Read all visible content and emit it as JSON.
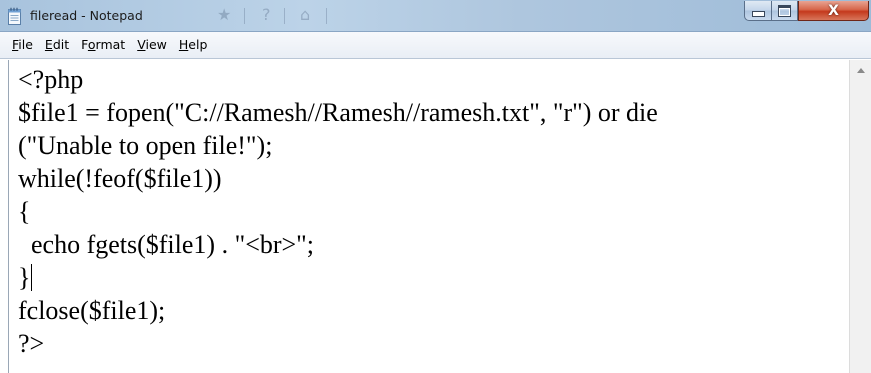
{
  "window": {
    "title": "fileread - Notepad"
  },
  "icons": {
    "app": "notepad-icon",
    "minimize": "minimize-icon",
    "maximize": "maximize-icon",
    "close": "close-icon",
    "scroll_up": "scroll-up-arrow-icon"
  },
  "caption": {
    "close_glyph": "X"
  },
  "menu": {
    "items": [
      {
        "key": "F",
        "rest": "ile"
      },
      {
        "key": "E",
        "rest": "dit"
      },
      {
        "pre": "F",
        "key": "o",
        "rest": "rmat"
      },
      {
        "key": "V",
        "rest": "iew"
      },
      {
        "key": "H",
        "rest": "elp"
      }
    ]
  },
  "editor": {
    "lines": [
      "<?php",
      "$file1 = fopen(\"C://Ramesh//Ramesh//ramesh.txt\", \"r\") or die",
      "(\"Unable to open file!\");",
      "while(!feof($file1))",
      "{",
      "  echo fgets($file1) . \"<br>\";",
      "}",
      "fclose($file1);",
      "?>"
    ]
  },
  "colors": {
    "titlebar": "#bcd3e8",
    "close_button": "#c4391c",
    "menubar": "#eef2f7",
    "text": "#000000"
  }
}
